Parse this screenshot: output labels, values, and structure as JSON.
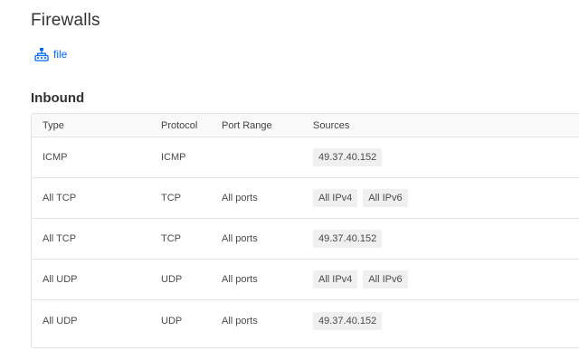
{
  "page": {
    "title": "Firewalls"
  },
  "resource": {
    "label": "file",
    "icon": "droplet-resource-icon"
  },
  "inbound": {
    "title": "Inbound",
    "columns": {
      "type": "Type",
      "protocol": "Protocol",
      "port_range": "Port Range",
      "sources": "Sources"
    },
    "rows": [
      {
        "type": "ICMP",
        "protocol": "ICMP",
        "port_range": "",
        "sources": [
          "49.37.40.152"
        ]
      },
      {
        "type": "All TCP",
        "protocol": "TCP",
        "port_range": "All ports",
        "sources": [
          "All IPv4",
          "All IPv6"
        ]
      },
      {
        "type": "All TCP",
        "protocol": "TCP",
        "port_range": "All ports",
        "sources": [
          "49.37.40.152"
        ]
      },
      {
        "type": "All UDP",
        "protocol": "UDP",
        "port_range": "All ports",
        "sources": [
          "All IPv4",
          "All IPv6"
        ]
      },
      {
        "type": "All UDP",
        "protocol": "UDP",
        "port_range": "All ports",
        "sources": [
          "49.37.40.152"
        ]
      }
    ]
  },
  "colors": {
    "link": "#0069ff",
    "border": "#e3e3e3",
    "tag_bg": "#f0f0f0"
  }
}
